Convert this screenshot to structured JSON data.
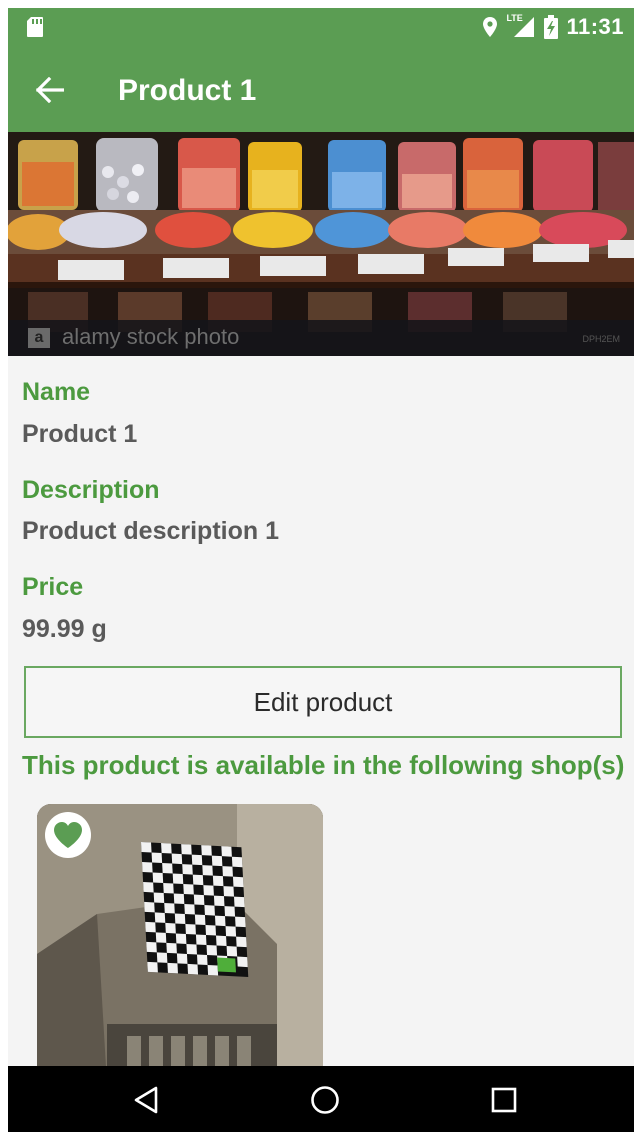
{
  "statusbar": {
    "time": "11:31",
    "network_label": "LTE",
    "icons": [
      "sd-card-icon",
      "location-pin-icon",
      "signal-icon",
      "battery-charging-icon"
    ]
  },
  "appbar": {
    "title": "Product 1",
    "back_icon": "arrow-left-icon"
  },
  "hero": {
    "watermark_text": "alamy stock photo",
    "watermark_logo": "a",
    "image_code": "DPH2EM"
  },
  "product": {
    "name_label": "Name",
    "name_value": "Product 1",
    "description_label": "Description",
    "description_value": "Product description 1",
    "price_label": "Price",
    "price_value": "99.99 g"
  },
  "actions": {
    "edit_label": "Edit product"
  },
  "shops": {
    "title": "This product is available in the following shop(s)",
    "favorite_icon": "heart-icon"
  },
  "navbar": {
    "icons": [
      "back-triangle-icon",
      "home-circle-icon",
      "recents-square-icon"
    ]
  },
  "colors": {
    "primary": "#5b9d53",
    "accent_text": "#4c9a3f",
    "body_text": "#5a5a5a",
    "background": "#f4f4f4"
  }
}
